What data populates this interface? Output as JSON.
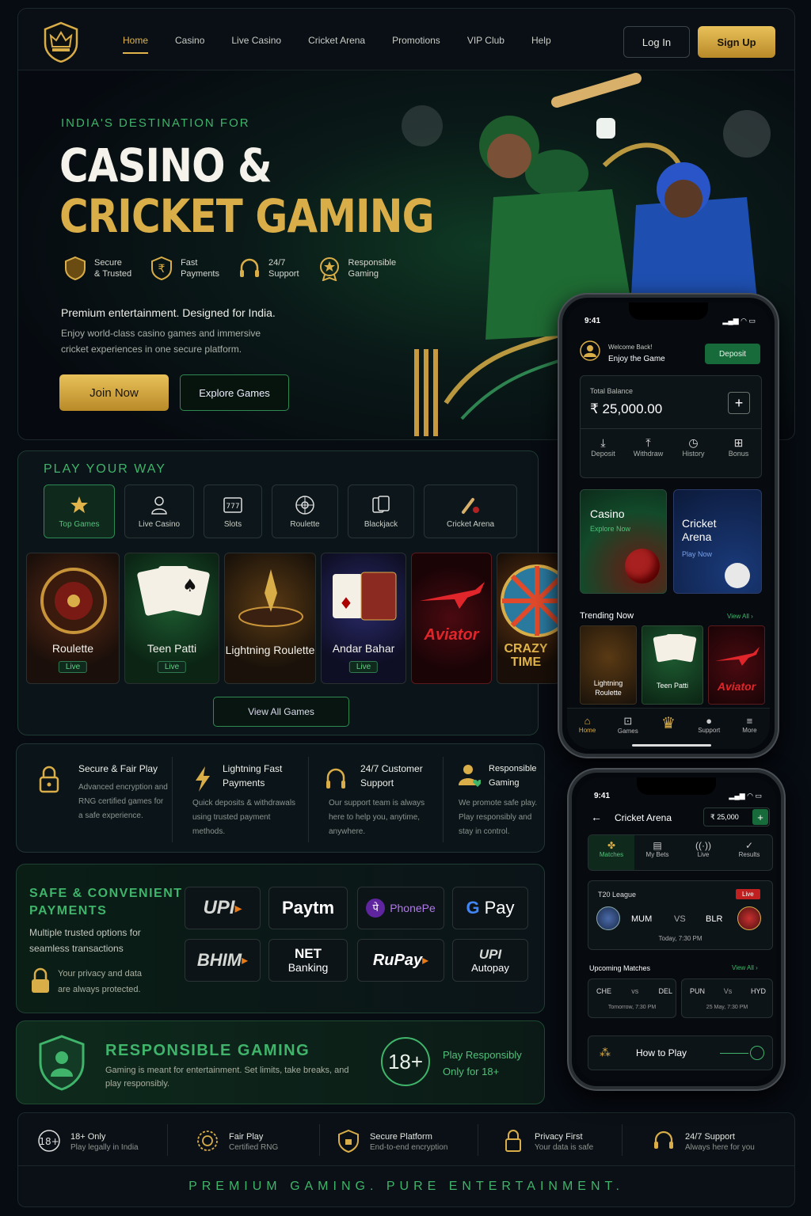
{
  "nav": {
    "links": [
      "Home",
      "Casino",
      "Live Casino",
      "Cricket Arena",
      "Promotions",
      "VIP Club",
      "Help"
    ],
    "login": "Log In",
    "signup": "Sign Up"
  },
  "hero": {
    "kicker": "INDIA'S DESTINATION FOR",
    "title1": "CASINO &",
    "title2": "CRICKET GAMING",
    "features": [
      {
        "a": "Secure",
        "b": "& Trusted"
      },
      {
        "a": "Fast",
        "b": "Payments"
      },
      {
        "a": "24/7",
        "b": "Support"
      },
      {
        "a": "Responsible",
        "b": "Gaming"
      }
    ],
    "lead": "Premium entertainment. Designed for India.",
    "sub": "Enjoy world-class casino games and immersive cricket experiences in one secure platform.",
    "join": "Join Now",
    "explore": "Explore Games"
  },
  "play": {
    "title": "PLAY YOUR WAY",
    "cats": [
      "Top Games",
      "Live Casino",
      "Slots",
      "Roulette",
      "Blackjack",
      "Cricket Arena"
    ],
    "games": [
      {
        "name": "Roulette",
        "live": "Live"
      },
      {
        "name": "Teen Patti",
        "live": "Live"
      },
      {
        "name": "Lightning Roulette",
        "live": ""
      },
      {
        "name": "Andar Bahar",
        "live": "Live"
      },
      {
        "name": "Aviator",
        "live": ""
      },
      {
        "name": "CRAZY TIME",
        "live": ""
      }
    ],
    "view_all": "View All Games"
  },
  "trust": [
    {
      "h": "Secure & Fair Play",
      "p": "Advanced encryption and RNG certified games for a safe experience."
    },
    {
      "h": "Lightning Fast Payments",
      "p": "Quick deposits & withdrawals using trusted payment methods."
    },
    {
      "h": "24/7 Customer Support",
      "p": "Our support team is always here to help you, anytime, anywhere."
    },
    {
      "h": "Responsible Gaming",
      "p": "We promote safe play. Play responsibly and stay in control."
    }
  ],
  "payments": {
    "title1": "SAFE & CONVENIENT",
    "title2": "PAYMENTS",
    "desc": "Multiple trusted options for seamless transactions",
    "privacy": "Your privacy and data are always protected.",
    "logos": [
      "UPI",
      "Paytm",
      "PhonePe",
      "Pay",
      "BHIM",
      "NET",
      "Banking",
      "RuPay",
      "UPI",
      "Autopay"
    ]
  },
  "responsible": {
    "title": "RESPONSIBLE GAMING",
    "text": "Gaming is meant for entertainment. Set limits, take breaks, and play responsibly.",
    "badge": "18+",
    "play1": "Play Responsibly",
    "play2": "Only for 18+"
  },
  "footer": {
    "items": [
      {
        "a": "18+ Only",
        "b": "Play legally in India"
      },
      {
        "a": "Fair Play",
        "b": "Certified RNG"
      },
      {
        "a": "Secure Platform",
        "b": "End-to-end encryption"
      },
      {
        "a": "Privacy First",
        "b": "Your data is safe"
      },
      {
        "a": "24/7 Support",
        "b": "Always here for you"
      }
    ],
    "tagline": "PREMIUM GAMING.  PURE ENTERTAINMENT."
  },
  "phone1": {
    "time": "9:41",
    "welcome": "Welcome Back!",
    "enjoy": "Enjoy the Game",
    "deposit": "Deposit",
    "balance_label": "Total Balance",
    "balance": "₹ 25,000.00",
    "actions": [
      "Deposit",
      "Withdraw",
      "History",
      "Bonus"
    ],
    "casino": "Casino",
    "casino_cta": "Explore Now",
    "cricket": "Cricket Arena",
    "cricket_cta": "Play Now",
    "trending": "Trending Now",
    "view_all": "View All",
    "trend_games": [
      "Lightning Roulette",
      "Teen Patti",
      "Aviator"
    ],
    "tabs": [
      "Home",
      "Games",
      "",
      "Support",
      "More"
    ]
  },
  "phone2": {
    "time": "9:41",
    "title": "Cricket Arena",
    "balance": "₹ 25,000",
    "tabs": [
      "Matches",
      "My Bets",
      "Live",
      "Results"
    ],
    "league": "T20 League",
    "live": "Live",
    "team1": "MUM",
    "vs": "VS",
    "team2": "BLR",
    "when": "Today, 7:30 PM",
    "upcoming": "Upcoming Matches",
    "view_all": "View All",
    "m1": {
      "a": "CHE",
      "vs": "vs",
      "b": "DEL",
      "t": "Tomorrow, 7:30 PM"
    },
    "m2": {
      "a": "PUN",
      "vs": "Vs",
      "b": "HYD",
      "t": "25 May, 7:30 PM"
    },
    "howto": "How to Play"
  },
  "colors": {
    "accent_green": "#3fb46a",
    "gold": "#d9ad48",
    "bg": "#070b12"
  }
}
